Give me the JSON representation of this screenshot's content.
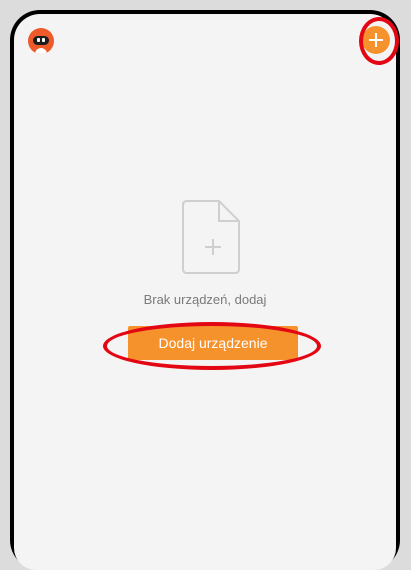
{
  "header": {
    "avatar_icon": "robot-avatar-icon",
    "add_icon": "plus-icon",
    "accent_color": "#f6922b"
  },
  "empty_state": {
    "icon": "add-file-icon",
    "message": "Brak urządzeń, dodaj",
    "button_label": "Dodaj urządzenie"
  },
  "annotations": {
    "highlight_color": "#e30613"
  }
}
